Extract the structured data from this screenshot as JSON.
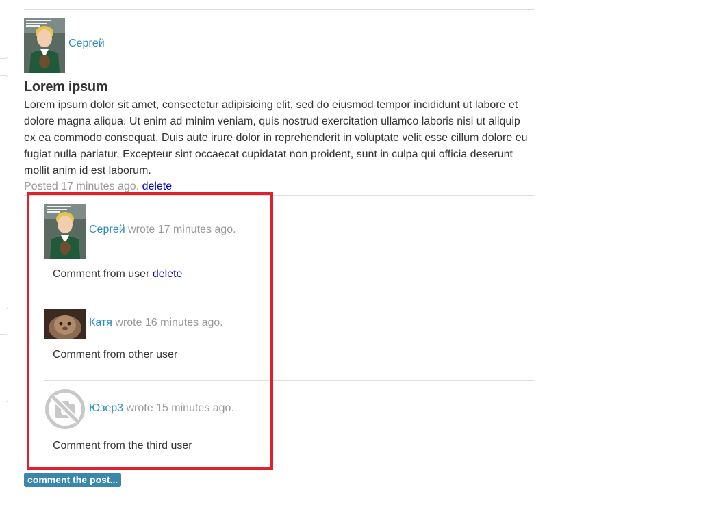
{
  "post": {
    "author": "Сергей",
    "title": "Lorem ipsum",
    "body": "Lorem ipsum dolor sit amet, consectetur adipisicing elit, sed do eiusmod tempor incididunt ut labore et dolore magna aliqua. Ut enim ad minim veniam, quis nostrud exercitation ullamco laboris nisi ut aliquip ex ea commodo consequat. Duis aute irure dolor in reprehenderit in voluptate velit esse cillum dolore eu fugiat nulla pariatur. Excepteur sint occaecat cupidatat non proident, sunt in culpa qui officia deserunt mollit anim id est laborum.",
    "posted_text": "Posted 17 minutes ago.",
    "delete_label": "delete"
  },
  "comments": [
    {
      "author": "Сергей",
      "wrote": "wrote 17 minutes ago.",
      "text": "Comment from user",
      "delete_label": "delete",
      "avatar": "boy-photo"
    },
    {
      "author": "Катя",
      "wrote": "wrote 16 minutes ago.",
      "text": "Comment from other user",
      "avatar": "cat-photo"
    },
    {
      "author": "Юзер3",
      "wrote": "wrote 15 minutes ago.",
      "text": "Comment from the third user",
      "avatar": "no-photo-icon"
    }
  ],
  "comment_button": "comment the post...",
  "colors": {
    "link": "#2a8bc4",
    "delete_link": "#0000cc",
    "highlight_border": "#e0202a",
    "button": "#3a87ad",
    "muted": "#999999"
  }
}
